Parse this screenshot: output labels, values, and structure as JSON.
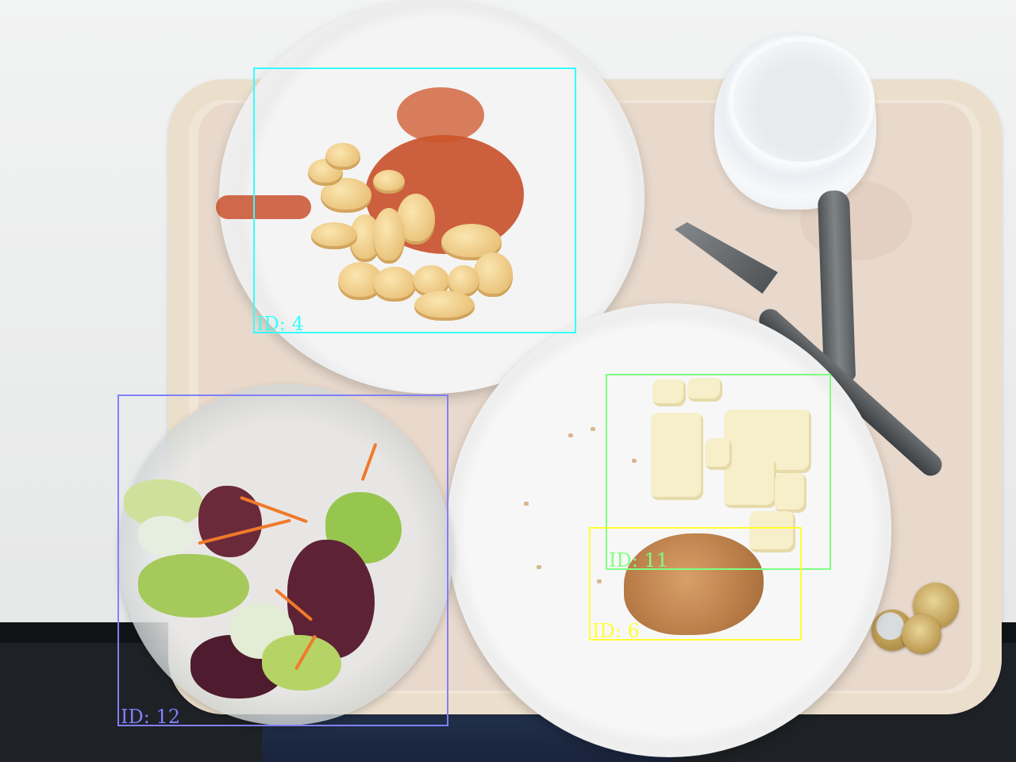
{
  "scene": {
    "description_objects": [
      "pasta-bowl",
      "dinner-plate",
      "salad-bowl",
      "plastic-cup",
      "fork",
      "knife",
      "coins",
      "tray"
    ]
  },
  "detections": [
    {
      "id_label": "ID: 4",
      "color": "#33ffff"
    },
    {
      "id_label": "ID: 12",
      "color": "#8080ff"
    },
    {
      "id_label": "ID: 11",
      "color": "#80ff80"
    },
    {
      "id_label": "ID: 6",
      "color": "#ffff33"
    }
  ]
}
